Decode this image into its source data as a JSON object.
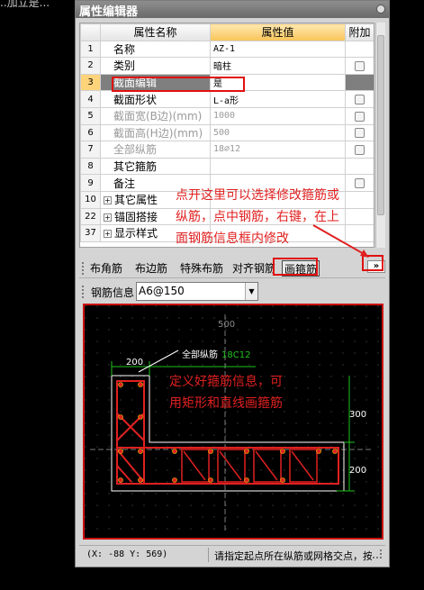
{
  "background": {
    "text": "..加立是..."
  },
  "window": {
    "title": "属性编辑器"
  },
  "grid": {
    "headers": {
      "name": "属性名称",
      "value": "属性值",
      "extra": "附加"
    },
    "rows": [
      {
        "num": "1",
        "name": "名称",
        "value": "AZ-1",
        "checkbox": false,
        "grey": false
      },
      {
        "num": "2",
        "name": "类别",
        "value": "暗柱",
        "checkbox": true,
        "grey": false
      },
      {
        "num": "3",
        "name": "截面编辑",
        "value": "是",
        "checkbox": false,
        "grey": false,
        "selected": true
      },
      {
        "num": "4",
        "name": "截面形状",
        "value": "L-a形",
        "checkbox": true,
        "grey": false
      },
      {
        "num": "5",
        "name": "截面宽(B边)(mm)",
        "value": "1000",
        "checkbox": true,
        "grey": true
      },
      {
        "num": "6",
        "name": "截面高(H边)(mm)",
        "value": "500",
        "checkbox": true,
        "grey": true
      },
      {
        "num": "7",
        "name": "全部纵筋",
        "value": "18⌀12",
        "checkbox": true,
        "grey": true
      },
      {
        "num": "8",
        "name": "其它箍筋",
        "value": "",
        "checkbox": false,
        "grey": false
      },
      {
        "num": "9",
        "name": "备注",
        "value": "",
        "checkbox": true,
        "grey": false
      },
      {
        "num": "10",
        "name": "其它属性",
        "value": "",
        "checkbox": false,
        "grey": false,
        "expander": true
      },
      {
        "num": "22",
        "name": "锚固搭接",
        "value": "",
        "checkbox": false,
        "grey": false,
        "expander": true
      },
      {
        "num": "37",
        "name": "显示样式",
        "value": "",
        "checkbox": false,
        "grey": false,
        "expander": true
      }
    ]
  },
  "annotations": {
    "top_line1": "点开这里可以选择修改箍筋或",
    "top_line2": "纵筋，点中钢筋，右键，在上",
    "top_line3": "面钢筋信息框内修改",
    "canvas_line1": "定义好箍筋信息，可",
    "canvas_line2": "用矩形和直线画箍筋"
  },
  "toolbar": {
    "items": [
      "布角筋",
      "布边筋",
      "特殊布筋",
      "对齐钢筋",
      "画箍筋"
    ],
    "active": "画箍筋",
    "more_label": "»"
  },
  "rebar": {
    "label": "钢筋信息",
    "value": "A6@150"
  },
  "canvas": {
    "dim_top": "500",
    "dim_left": "200",
    "dim_right_upper": "300",
    "dim_right_lower": "200",
    "leader_label": "全部纵筋",
    "leader_value": "18C12"
  },
  "status": {
    "coord": "(X: -88 Y: 569)",
    "message": "请指定起点所在纵筋或网格交点，按"
  },
  "colors": {
    "rebar": "#e02020",
    "outline": "#ffffff",
    "dimension": "#1fc21f",
    "annotation": "#e02020"
  }
}
